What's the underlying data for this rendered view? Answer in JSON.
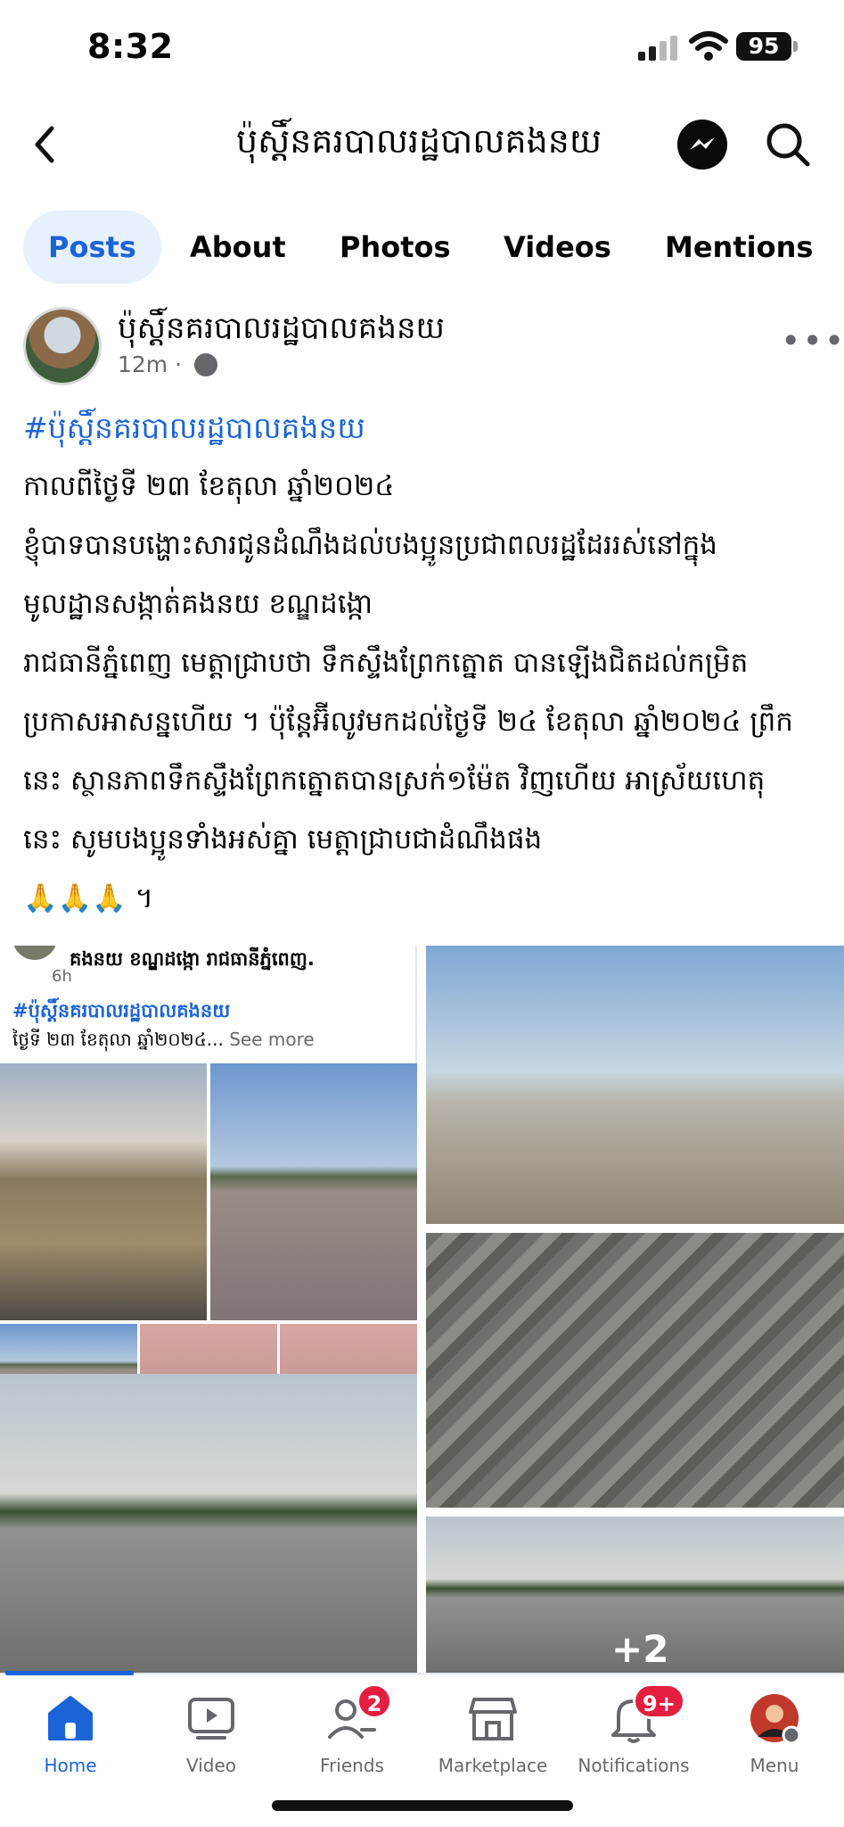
{
  "status_bar": {
    "time": "8:32",
    "battery": "95"
  },
  "header": {
    "title": "ប៉ុស្តិ៍នគរបាលរដ្ឋបាលគងនយ"
  },
  "tabs": [
    {
      "label": "Posts",
      "active": true
    },
    {
      "label": "About",
      "active": false
    },
    {
      "label": "Photos",
      "active": false
    },
    {
      "label": "Videos",
      "active": false
    },
    {
      "label": "Mentions",
      "active": false
    }
  ],
  "post": {
    "author": "ប៉ុស្តិ៍នគរបាលរដ្ឋបាលគងនយ",
    "time": "12m",
    "privacy_icon": "globe-icon",
    "hashtag": "#ប៉ុស្តិ៍នគរបាលរដ្ឋបាលគងនយ",
    "lines": [
      "កាលពីថ្ងៃទី ២៣ ខែតុលា ឆ្នាំ២០២៤",
      "ខ្ញុំបាទបានបង្ហោះសារជូនដំណឹងដល់បងប្អូនប្រជាពលរដ្ឋដែររស់នៅក្នុង",
      "មូលដ្ឋានសង្កាត់គងនយ ខណ្ឌដង្កោ",
      "រាជធានីភ្នំពេញ មេត្តាជ្រាបថា ទឹកស្ទឹងព្រែកត្នោត បានឡើងជិតដល់កម្រិត",
      "ប្រកាសអាសន្នហើយ ។ ប៉ុន្តែអ៊ីលូវមកដល់ថ្ងៃទី ២៤ ខែតុលា ឆ្នាំ២០២៤ ព្រឹក",
      "នេះ ស្ថានភាពទឹកស្ទឹងព្រែកត្នោតបានស្រក់១ម៉ែត វិញហើយ អាស្រ័យហេតុ",
      "នេះ សូមបងប្អូនទាំងអស់គ្នា មេត្តាជ្រាបជាដំណឹងផង",
      "🙏🙏🙏 ។"
    ],
    "embedded_screenshot": {
      "location_line": "គងនយ ខណ្ឌដង្កោ រាជធានីភ្នំពេញ.",
      "time": "6h",
      "hashtag": "#ប៉ុស្តិ៍នគរបាលរដ្ឋបាលគងនយ",
      "excerpt": "ថ្ងៃទី ២៣ ខែតុលា ឆ្នាំ២០២៤...",
      "see_more": "See more"
    },
    "more_photos": "+2"
  },
  "bottom_nav": [
    {
      "label": "Home",
      "icon": "home-icon",
      "active": true,
      "badge": ""
    },
    {
      "label": "Video",
      "icon": "video-icon",
      "active": false,
      "badge": ""
    },
    {
      "label": "Friends",
      "icon": "friends-icon",
      "active": false,
      "badge": "2"
    },
    {
      "label": "Marketplace",
      "icon": "marketplace-icon",
      "active": false,
      "badge": ""
    },
    {
      "label": "Notifications",
      "icon": "bell-icon",
      "active": false,
      "badge": "9+"
    },
    {
      "label": "Menu",
      "icon": "profile-avatar",
      "active": false,
      "badge": ""
    }
  ],
  "colors": {
    "accent": "#1b64d8",
    "badge": "#e41e3f",
    "secondary_text": "#65676b"
  }
}
